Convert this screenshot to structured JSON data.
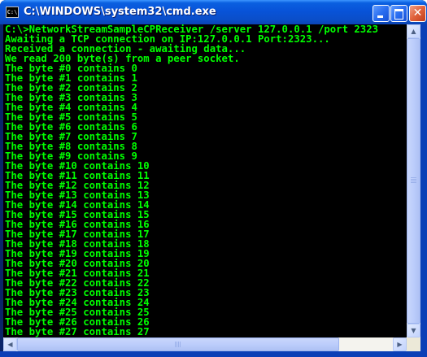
{
  "window": {
    "title": "C:\\WINDOWS\\system32\\cmd.exe",
    "icon_text": "C:\\",
    "icon": "cmd-icon"
  },
  "title_buttons": {
    "minimize": "minimize-icon",
    "maximize": "maximize-icon",
    "close": "close-icon",
    "close_glyph": "✕"
  },
  "colors": {
    "console_background": "#000000",
    "console_text": "#00ff00",
    "titlebar": "#0a5fe0"
  },
  "console": {
    "lines": [
      "C:\\>NetworkStreamSampleCPReceiver /server 127.0.0.1 /port 2323",
      "Awaiting a TCP connection on IP:127.0.0.1 Port:2323...",
      "Received a connection - awaiting data...",
      "We read 200 byte(s) from a peer socket.",
      "The byte #0 contains 0",
      "The byte #1 contains 1",
      "The byte #2 contains 2",
      "The byte #3 contains 3",
      "The byte #4 contains 4",
      "The byte #5 contains 5",
      "The byte #6 contains 6",
      "The byte #7 contains 7",
      "The byte #8 contains 8",
      "The byte #9 contains 9",
      "The byte #10 contains 10",
      "The byte #11 contains 11",
      "The byte #12 contains 12",
      "The byte #13 contains 13",
      "The byte #14 contains 14",
      "The byte #15 contains 15",
      "The byte #16 contains 16",
      "The byte #17 contains 17",
      "The byte #18 contains 18",
      "The byte #19 contains 19",
      "The byte #20 contains 20",
      "The byte #21 contains 21",
      "The byte #22 contains 22",
      "The byte #23 contains 23",
      "The byte #24 contains 24",
      "The byte #25 contains 25",
      "The byte #26 contains 26",
      "The byte #27 contains 27"
    ]
  },
  "scrollbars": {
    "up_arrow": "▲",
    "down_arrow": "▼",
    "left_arrow": "◀",
    "right_arrow": "▶"
  }
}
